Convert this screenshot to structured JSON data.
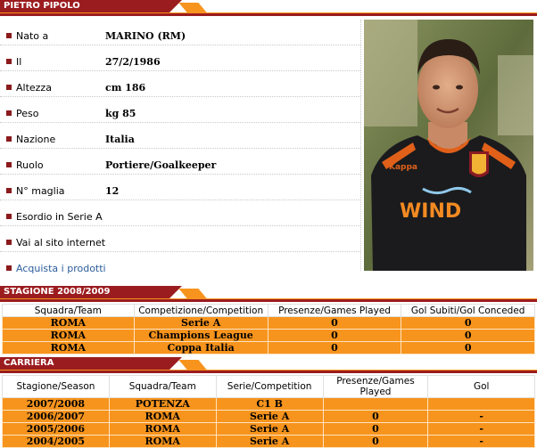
{
  "player_header": "PIETRO PIPOLO",
  "info_rows": [
    {
      "label": "Nato a",
      "value": "MARINO (RM)"
    },
    {
      "label": "Il",
      "value": "27/2/1986"
    },
    {
      "label": "Altezza",
      "value": "cm 186"
    },
    {
      "label": "Peso",
      "value": "kg 85"
    },
    {
      "label": "Nazione",
      "value": "Italia"
    },
    {
      "label": "Ruolo",
      "value": "Portiere/Goalkeeper"
    },
    {
      "label": "N° maglia",
      "value": "12"
    },
    {
      "label": "Esordio in Serie A",
      "value": ""
    },
    {
      "label": "Vai al sito internet",
      "value": ""
    },
    {
      "label": "Acquista i prodotti",
      "value": ""
    }
  ],
  "photo": {
    "shirt_brand": "Kappa",
    "sponsor": "WIND"
  },
  "season": {
    "header": "STAGIONE 2008/2009",
    "columns": [
      "Squadra/Team",
      "Competizione/Competition",
      "Presenze/Games Played",
      "Gol Subiti/Gol Conceded"
    ],
    "rows": [
      [
        "ROMA",
        "Serie A",
        "0",
        "0"
      ],
      [
        "ROMA",
        "Champions League",
        "0",
        "0"
      ],
      [
        "ROMA",
        "Coppa Italia",
        "0",
        "0"
      ]
    ]
  },
  "career": {
    "header": "CARRIERA",
    "columns": [
      "Stagione/Season",
      "Squadra/Team",
      "Serie/Competition",
      "Presenze/Games Played",
      "Gol"
    ],
    "rows": [
      [
        "2007/2008",
        "POTENZA",
        "C1 B",
        "",
        ""
      ],
      [
        "2006/2007",
        "ROMA",
        "Serie A",
        "0",
        "-"
      ],
      [
        "2005/2006",
        "ROMA",
        "Serie A",
        "0",
        "-"
      ],
      [
        "2004/2005",
        "ROMA",
        "Serie A",
        "0",
        "-"
      ]
    ]
  },
  "colors": {
    "header_red": "#9b1c1f",
    "accent_orange": "#f7941d",
    "link_blue": "#2a5c9a"
  }
}
